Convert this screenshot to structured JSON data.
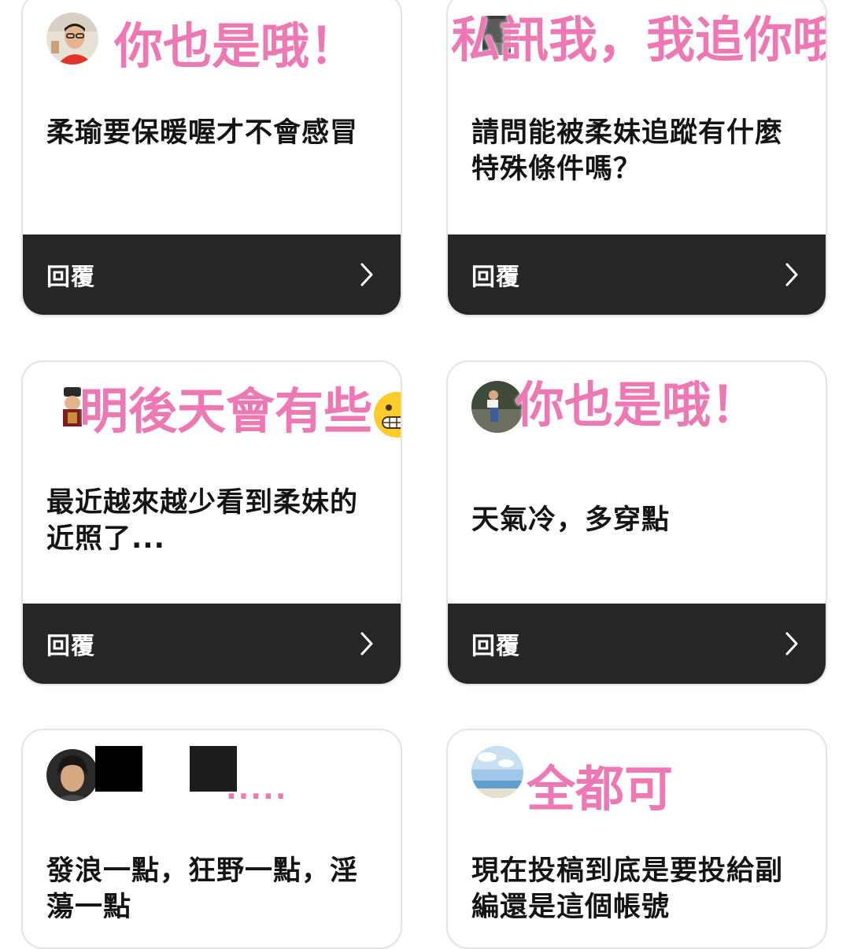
{
  "cards": [
    {
      "overlay": "你也是哦！",
      "question": "柔瑜要保暖喔才不會感冒",
      "reply_label": "回覆"
    },
    {
      "overlay": "私訊我，我追你哦",
      "question": "請問能被柔妹追蹤有什麼特殊條件嗎？",
      "reply_label": "回覆"
    },
    {
      "overlay": "明後天會有些",
      "question": "最近越來越少看到柔妹的近照了...",
      "reply_label": "回覆"
    },
    {
      "overlay": "你也是哦！",
      "question": "天氣冷，多穿點",
      "reply_label": "回覆"
    },
    {
      "overlay": ".....",
      "question": "發浪一點，狂野一點，淫蕩一點",
      "reply_label": ""
    },
    {
      "overlay": "全都可",
      "question": "現在投稿到底是要投給副編還是這個帳號",
      "reply_label": ""
    }
  ],
  "colors": {
    "overlay_pink": "#ee78b4",
    "reply_bar": "#262626",
    "card_border": "#e4e4e4"
  },
  "icons": {
    "reply_arrow": "chevron-right-icon",
    "overlay_emoji": "grimacing-face-emoji"
  }
}
